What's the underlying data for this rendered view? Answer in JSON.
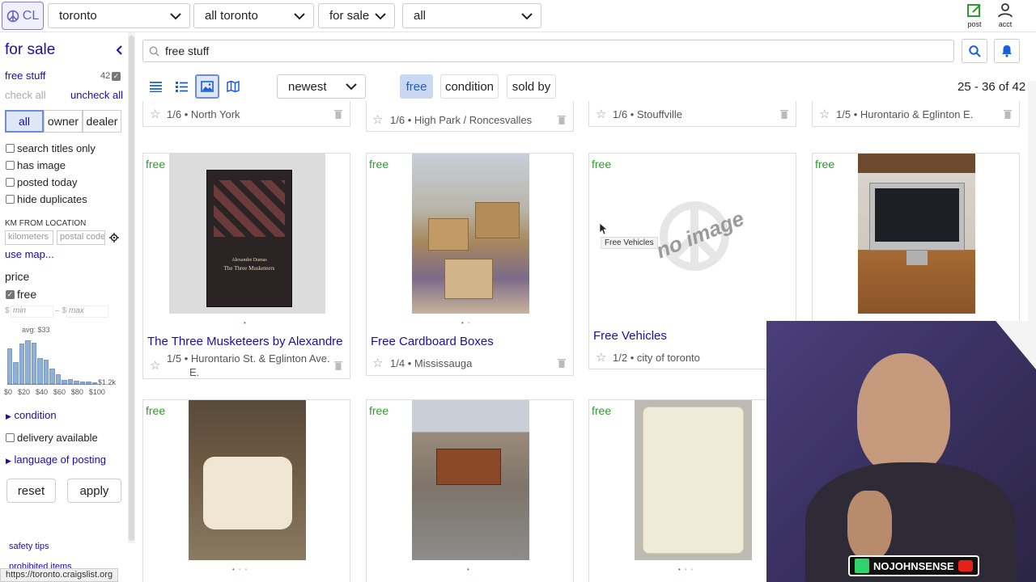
{
  "topbar": {
    "logo_text": "CL",
    "location": "toronto",
    "area": "all toronto",
    "category": "for sale",
    "subcategory": "all",
    "post_label": "post",
    "acct_label": "acct"
  },
  "sidebar": {
    "heading": "for sale",
    "saved_search": "free stuff",
    "saved_count": "42",
    "check_all": "check all",
    "uncheck_all": "uncheck all",
    "seller": [
      "all",
      "owner",
      "dealer"
    ],
    "filters": [
      "search titles only",
      "has image",
      "posted today",
      "hide duplicates"
    ],
    "km_label": "KM FROM LOCATION",
    "km_placeholder": "kilometers",
    "postal_placeholder": "postal code",
    "use_map": "use map...",
    "price_label": "price",
    "free_label": "free",
    "min_placeholder": "min",
    "max_placeholder": "max",
    "avg_label": "avg: $33",
    "hist_labels": [
      "$0",
      "$20",
      "$40",
      "$60",
      "$80",
      "$100",
      "$1.2k"
    ],
    "condition": "condition",
    "delivery": "delivery available",
    "language": "language of posting",
    "reset": "reset",
    "apply": "apply",
    "safety": "safety tips",
    "prohibited": "prohibited items"
  },
  "histogram": {
    "values": [
      0.82,
      0.5,
      0.92,
      1.0,
      0.95,
      0.6,
      0.55,
      0.35,
      0.22,
      0.1,
      0.12,
      0.08,
      0.06,
      0.05,
      0.04
    ]
  },
  "search": {
    "query": "free stuff"
  },
  "toolbar": {
    "sort": "newest",
    "chips": [
      "free",
      "condition",
      "sold by"
    ],
    "range": "25 - 36 of 42"
  },
  "listings_top": [
    {
      "date": "1/6",
      "loc": "North York"
    },
    {
      "date": "1/6",
      "loc": "High Park / Roncesvalles"
    },
    {
      "date": "1/6",
      "loc": "Stouffville"
    },
    {
      "date": "1/5",
      "loc": "Hurontario & Eglinton E."
    }
  ],
  "listings_mid": [
    {
      "badge": "free",
      "title": "The Three Musketeers by Alexandre ...",
      "date": "1/5",
      "loc": "Hurontario St. & Eglinton Ave.",
      "loc2": "E."
    },
    {
      "badge": "free",
      "title": "Free Cardboard Boxes",
      "date": "1/4",
      "loc": "Mississauga"
    },
    {
      "badge": "free",
      "title": "Free Vehicles",
      "date": "1/2",
      "loc": "city of toronto",
      "tooltip": "Free Vehicles",
      "noimage": "no image"
    },
    {
      "badge": "free"
    }
  ],
  "listings_bottom": [
    {
      "badge": "free"
    },
    {
      "badge": "free"
    },
    {
      "badge": "free"
    }
  ],
  "book": {
    "author": "Alexandre Dumas",
    "title": "The Three Musketeers"
  },
  "webcam": {
    "brand": "NOJOHNSENSE"
  },
  "status_url": "https://toronto.craigslist.org"
}
